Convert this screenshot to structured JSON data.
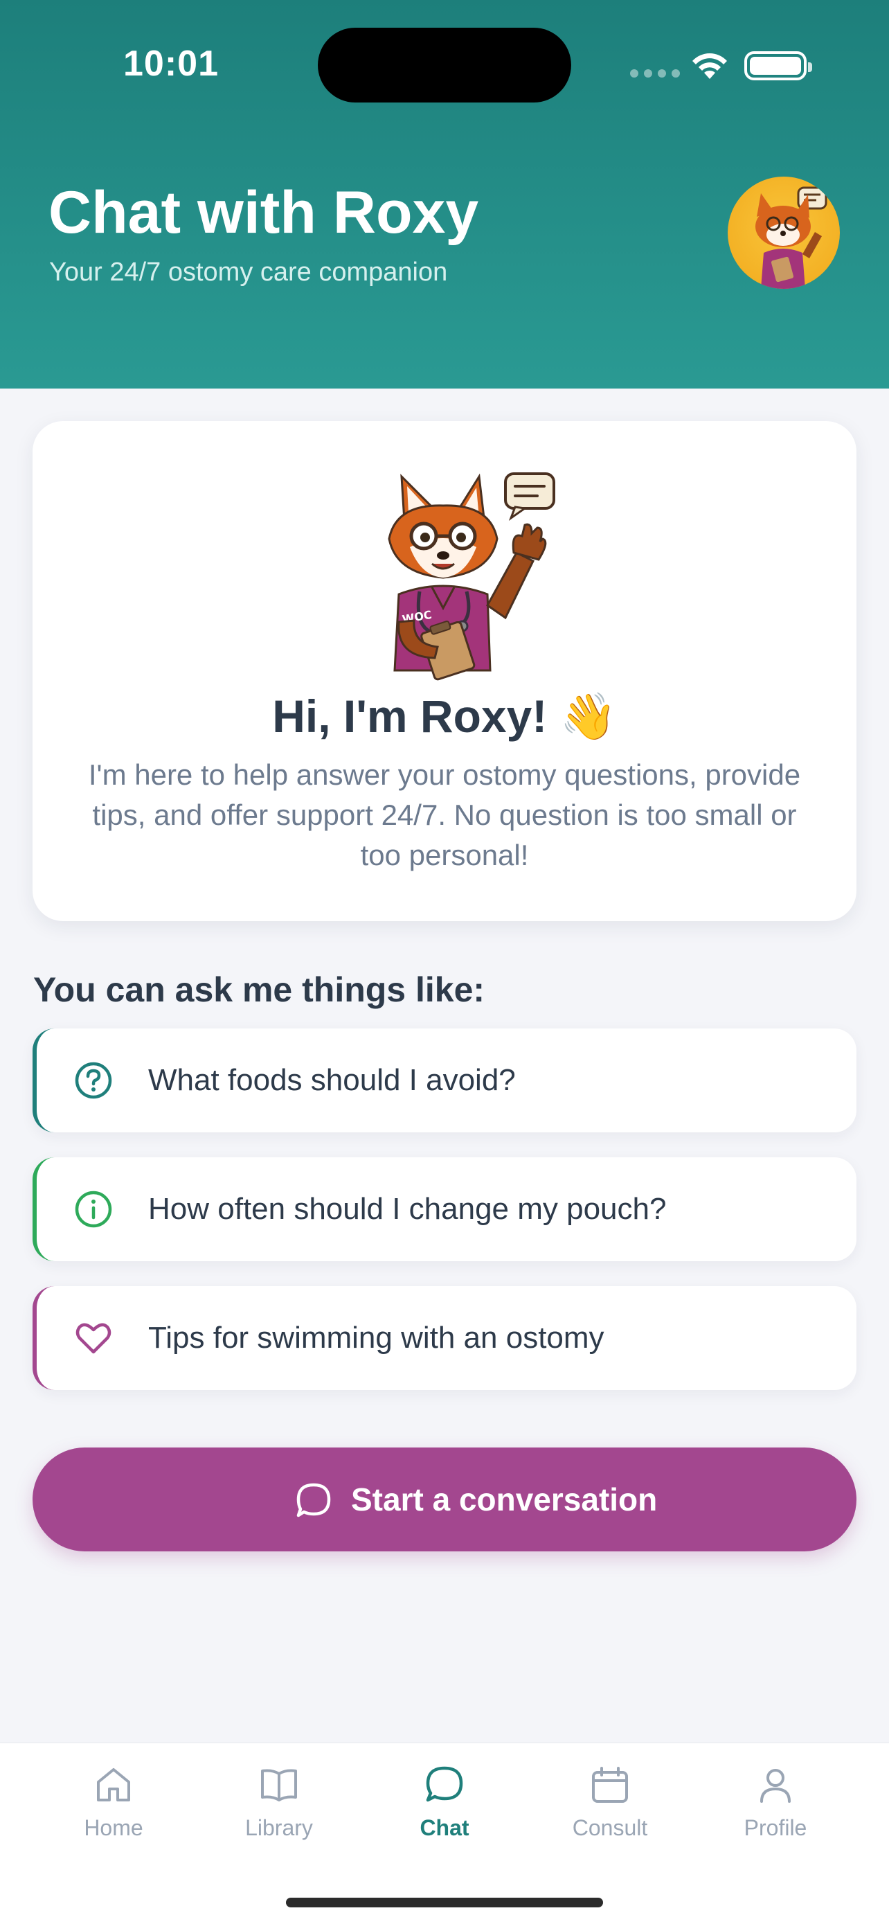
{
  "status_bar": {
    "time": "10:01"
  },
  "header": {
    "title": "Chat with Roxy",
    "subtitle": "Your 24/7 ostomy care companion",
    "avatar_icon": "roxy-fox-avatar"
  },
  "intro_card": {
    "greeting": "Hi, I'm Roxy! 👋",
    "body": "I'm here to help answer your ostomy questions, provide tips, and offer support 24/7. No question is too small or too personal!",
    "badge_text": "WOC"
  },
  "suggestions": {
    "title": "You can ask me things like:",
    "items": [
      {
        "label": "What foods should I avoid?",
        "icon": "question-circle-icon",
        "color": "#1f7f7b"
      },
      {
        "label": "How often should I change my pouch?",
        "icon": "info-circle-icon",
        "color": "#2eaa5a"
      },
      {
        "label": "Tips for swimming with an ostomy",
        "icon": "heart-icon",
        "color": "#a3478f"
      }
    ]
  },
  "cta": {
    "label": "Start a conversation",
    "icon": "chat-bubble-icon",
    "color": "#a3478f"
  },
  "tabs": [
    {
      "label": "Home",
      "icon": "home-icon",
      "active": false
    },
    {
      "label": "Library",
      "icon": "book-icon",
      "active": false
    },
    {
      "label": "Chat",
      "icon": "chat-icon",
      "active": true
    },
    {
      "label": "Consult",
      "icon": "calendar-icon",
      "active": false
    },
    {
      "label": "Profile",
      "icon": "person-icon",
      "active": false
    }
  ],
  "colors": {
    "header_start": "#1d7f7b",
    "header_end": "#2a9a93",
    "accent_teal": "#1f7f7b",
    "accent_purple": "#a3478f",
    "background": "#f4f5f9"
  }
}
